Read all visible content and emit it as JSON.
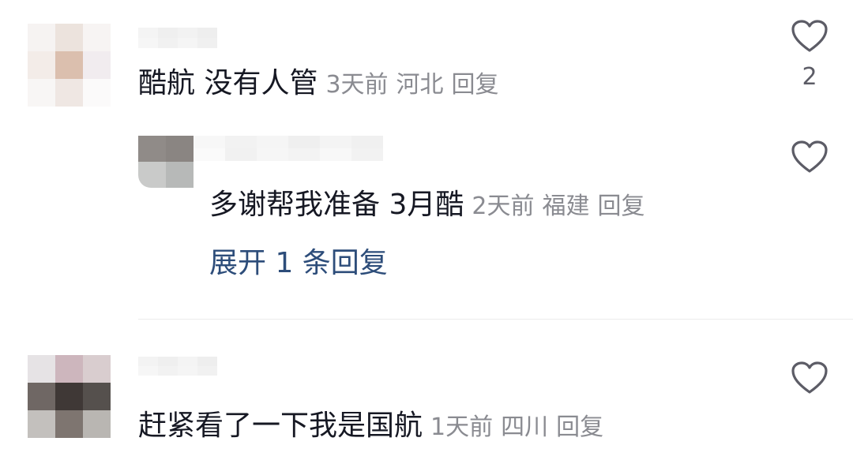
{
  "comments": [
    {
      "content": "酷航 没有人管",
      "time": "3天前",
      "region": "河北",
      "reply_label": "回复",
      "like_count": "2",
      "reply": {
        "content": "多谢帮我准备 3月酷",
        "time": "2天前",
        "region": "福建",
        "reply_label": "回复"
      },
      "expand_label": "展开 1 条回复"
    },
    {
      "content": "赶紧看了一下我是国航",
      "time": "1天前",
      "region": "四川",
      "reply_label": "回复"
    }
  ],
  "icons": {
    "like": "heart-outline-icon"
  },
  "colors": {
    "text": "#161823",
    "meta": "#8a8b91",
    "link": "#2d4d7a",
    "icon": "#5c5c66"
  }
}
